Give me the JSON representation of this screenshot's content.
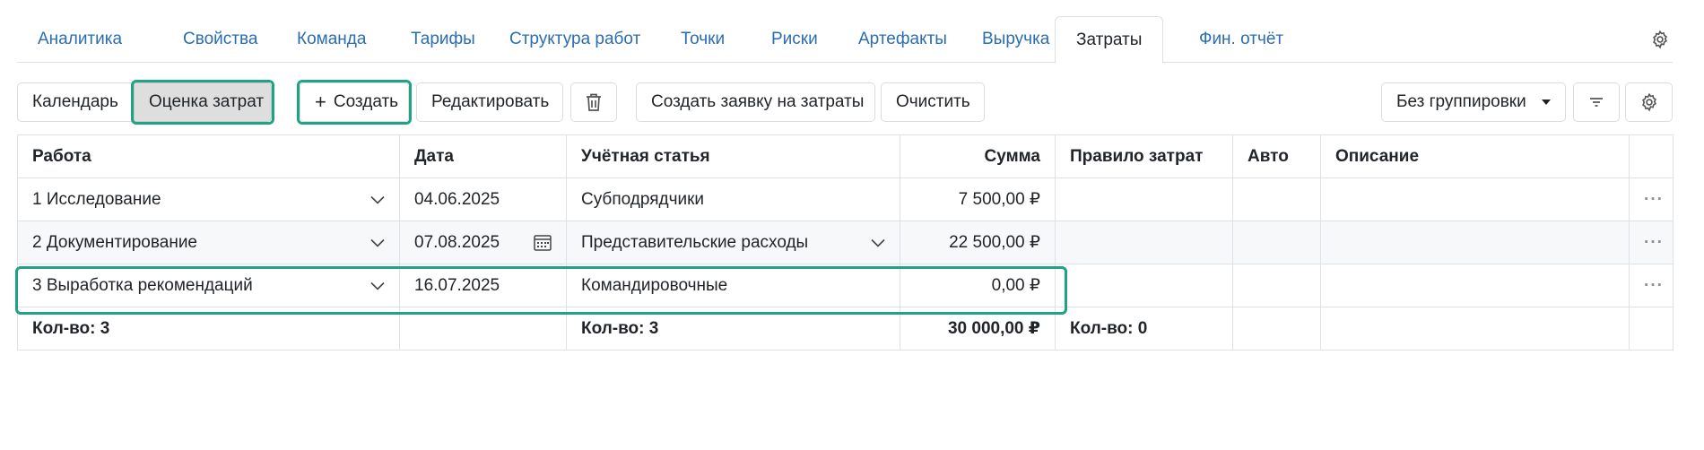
{
  "tabs": [
    {
      "label": "Аналитика"
    },
    {
      "label": "Свойства"
    },
    {
      "label": "Команда"
    },
    {
      "label": "Тарифы"
    },
    {
      "label": "Структура работ"
    },
    {
      "label": "Точки"
    },
    {
      "label": "Риски"
    },
    {
      "label": "Артефакты"
    },
    {
      "label": "Выручка"
    },
    {
      "label": "Затраты",
      "active": true
    },
    {
      "label": "Фин. отчёт"
    }
  ],
  "toolbar": {
    "calendar": "Календарь",
    "estimate": "Оценка затрат",
    "create": "Создать",
    "edit": "Редактировать",
    "create_request": "Создать заявку на затраты",
    "clear": "Очистить",
    "grouping": "Без группировки"
  },
  "table": {
    "headers": {
      "work": "Работа",
      "date": "Дата",
      "account": "Учётная статья",
      "sum": "Сумма",
      "rule": "Правило затрат",
      "auto": "Авто",
      "description": "Описание"
    },
    "rows": [
      {
        "work": "1 Исследование",
        "date": "04.06.2025",
        "account": "Субподрядчики",
        "sum": "7 500,00 ₽",
        "rule": "",
        "auto": "",
        "description": ""
      },
      {
        "work": "2 Документирование",
        "date": "07.08.2025",
        "account": "Представительские расходы",
        "sum": "22 500,00 ₽",
        "rule": "",
        "auto": "",
        "description": ""
      },
      {
        "work": "3 Выработка рекомендаций",
        "date": "16.07.2025",
        "account": "Командировочные",
        "sum": "0,00 ₽",
        "rule": "",
        "auto": "",
        "description": ""
      }
    ],
    "footer": {
      "work_count": "Кол-во: 3",
      "account_count": "Кол-во: 3",
      "sum_total": "30 000,00 ₽",
      "rule_count": "Кол-во: 0"
    }
  },
  "icons": {
    "more": "ellipsis-icon",
    "dropdown": "chevron-down-icon",
    "calendar": "calendar-icon",
    "trash": "trash-icon",
    "filter": "filter-icon",
    "settings": "gear-icon",
    "plus": "plus-icon"
  },
  "colors": {
    "link": "#2a6db2",
    "highlight": "#1ea384"
  }
}
